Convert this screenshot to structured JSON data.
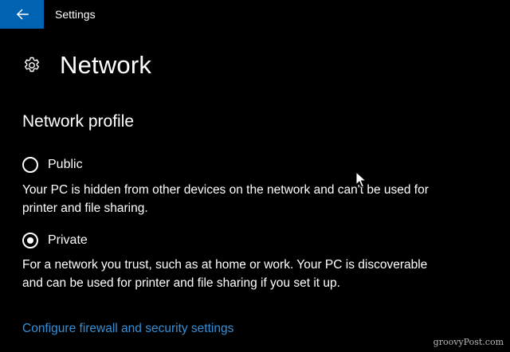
{
  "window": {
    "back_icon": "arrow-left-icon",
    "title": "Settings",
    "accent_color": "#0063b1"
  },
  "page": {
    "icon": "gear-icon",
    "title": "Network"
  },
  "network_profile": {
    "heading": "Network profile",
    "options": [
      {
        "label": "Public",
        "checked": false,
        "description": "Your PC is hidden from other devices on the network and can't be used for printer and file sharing."
      },
      {
        "label": "Private",
        "checked": true,
        "description": "For a network you trust, such as at home or work. Your PC is discoverable and can be used for printer and file sharing if you set it up."
      }
    ]
  },
  "links": {
    "firewall": "Configure firewall and security settings",
    "link_color": "#3390d8"
  },
  "watermark": "groovyPost.com"
}
